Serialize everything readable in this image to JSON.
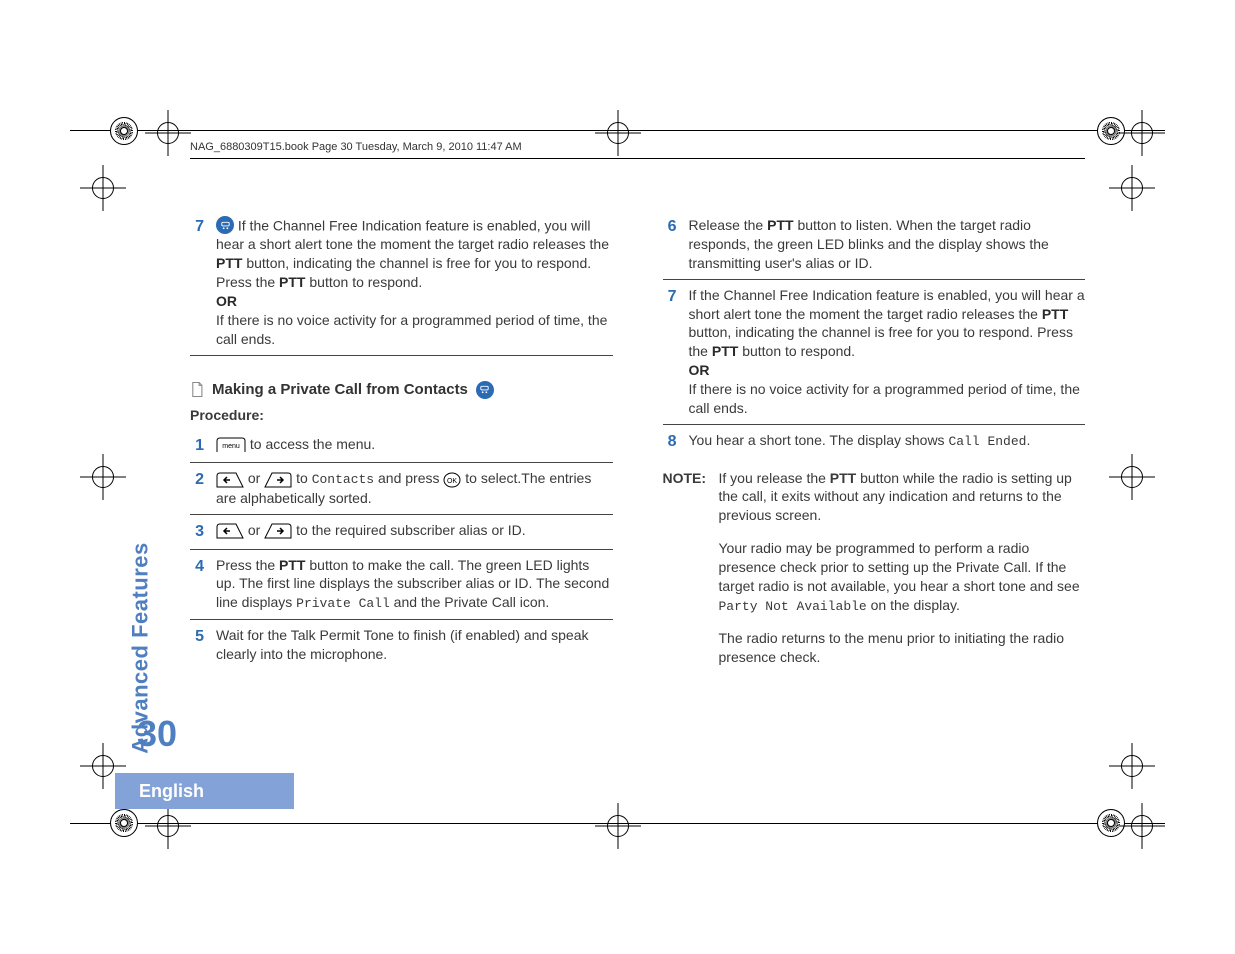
{
  "header_text": "NAG_6880309T15.book  Page 30  Tuesday, March 9, 2010  11:47 AM",
  "side_label": "Advanced Features",
  "page_number": "30",
  "language": "English",
  "col1": {
    "step7_a": " If the Channel Free Indication feature is enabled, you will hear a short alert tone the moment the target radio releases the ",
    "ptt": "PTT",
    "step7_b": " button, indicating the channel is free for you to respond. Press the ",
    "step7_c": " button to respond.",
    "or": "OR",
    "step7_d": "If there is no voice activity for a programmed period of time, the call ends.",
    "section_title": "Making a Private Call from Contacts",
    "procedure": "Procedure:",
    "s1": " to access the menu.",
    "s2_a": " or ",
    "s2_b": " to ",
    "contacts": "Contacts",
    "s2_c": " and press ",
    "s2_d": " to select.The entries are alphabetically sorted.",
    "s3_a": " or ",
    "s3_b": " to the required subscriber alias or ID.",
    "s4_a": "Press the ",
    "s4_b": " button to make the call. The green LED lights up. The first line displays the subscriber alias or ID. The second line displays ",
    "pc": "Private Call",
    "s4_c": " and the Private Call icon.",
    "s5": "Wait for the Talk Permit Tone to finish (if enabled) and speak clearly into the microphone."
  },
  "col2": {
    "s6_a": "Release the ",
    "ptt": "PTT",
    "s6_b": " button to listen. When the target radio responds, the green LED blinks and the display shows the transmitting user's alias or ID.",
    "s7_a": "If the Channel Free Indication feature is enabled, you will hear a short alert tone the moment the target radio releases the ",
    "s7_b": " button, indicating the channel is free for you to respond. Press the ",
    "s7_c": " button to respond.",
    "or": "OR",
    "s7_d": "If there is no voice activity for a programmed period of time, the call ends.",
    "s8_a": "You hear a short tone. The display shows ",
    "ce": "Call Ended",
    "s8_b": ".",
    "note_label": "NOTE:",
    "note1_a": "If you release the ",
    "note1_b": " button while the radio is setting up the call, it exits without any indication and returns to the previous screen.",
    "note2_a": "Your radio may be programmed to perform a radio presence check prior to setting up the Private Call. If the target radio is not available, you hear a short tone and see ",
    "pna": "Party Not Available",
    "note2_b": " on the display.",
    "note3": "The radio returns to the menu prior to initiating the radio presence check."
  },
  "nums": {
    "n1": "1",
    "n2": "2",
    "n3": "3",
    "n4": "4",
    "n5": "5",
    "n6": "6",
    "n7": "7",
    "n8": "8"
  }
}
